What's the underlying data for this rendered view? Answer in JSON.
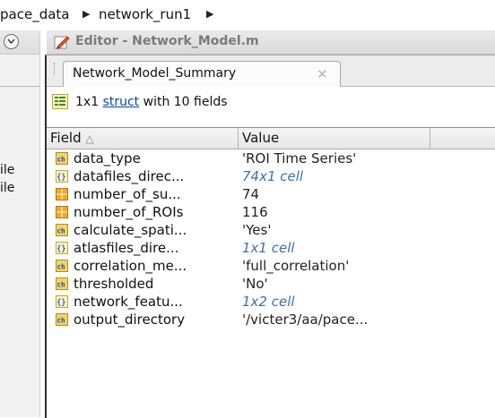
{
  "breadcrumb": {
    "parts": [
      "pace_data",
      "network_run1"
    ]
  },
  "left_panel": {
    "files": [
      "ile",
      "ile"
    ]
  },
  "editor": {
    "title": "Editor - Network_Model.m"
  },
  "variable_tab": {
    "label": "Network_Model_Summary"
  },
  "struct_info": {
    "size": "1x1",
    "type_link": "struct",
    "suffix": "with 10 fields"
  },
  "columns": {
    "field": "Field",
    "sort_indicator": "△",
    "value": "Value"
  },
  "rows": [
    {
      "icon": "char-icon",
      "field": "data_type",
      "value": "'ROI Time Series'"
    },
    {
      "icon": "cell-icon",
      "field": "datafiles_direc...",
      "value": "74x1 cell"
    },
    {
      "icon": "numeric-icon",
      "field": "number_of_su...",
      "value": "74"
    },
    {
      "icon": "numeric-icon",
      "field": "number_of_ROIs",
      "value": "116"
    },
    {
      "icon": "char-icon",
      "field": "calculate_spati...",
      "value": "'Yes'"
    },
    {
      "icon": "cell-icon",
      "field": "atlasfiles_dire...",
      "value": "1x1 cell"
    },
    {
      "icon": "char-icon",
      "field": "correlation_me...",
      "value": "'full_correlation'"
    },
    {
      "icon": "char-icon",
      "field": "thresholded",
      "value": "'No'"
    },
    {
      "icon": "cell-icon",
      "field": "network_featu...",
      "value": "1x2 cell"
    },
    {
      "icon": "char-icon",
      "field": "output_directory",
      "value": "'/victer3/aa/pace..."
    }
  ],
  "colors": {
    "cell_value": "#3b6fb0",
    "link": "#0645ad",
    "char_icon_bg": "#f3d36b",
    "numeric_icon_bg": "#f5a623"
  }
}
